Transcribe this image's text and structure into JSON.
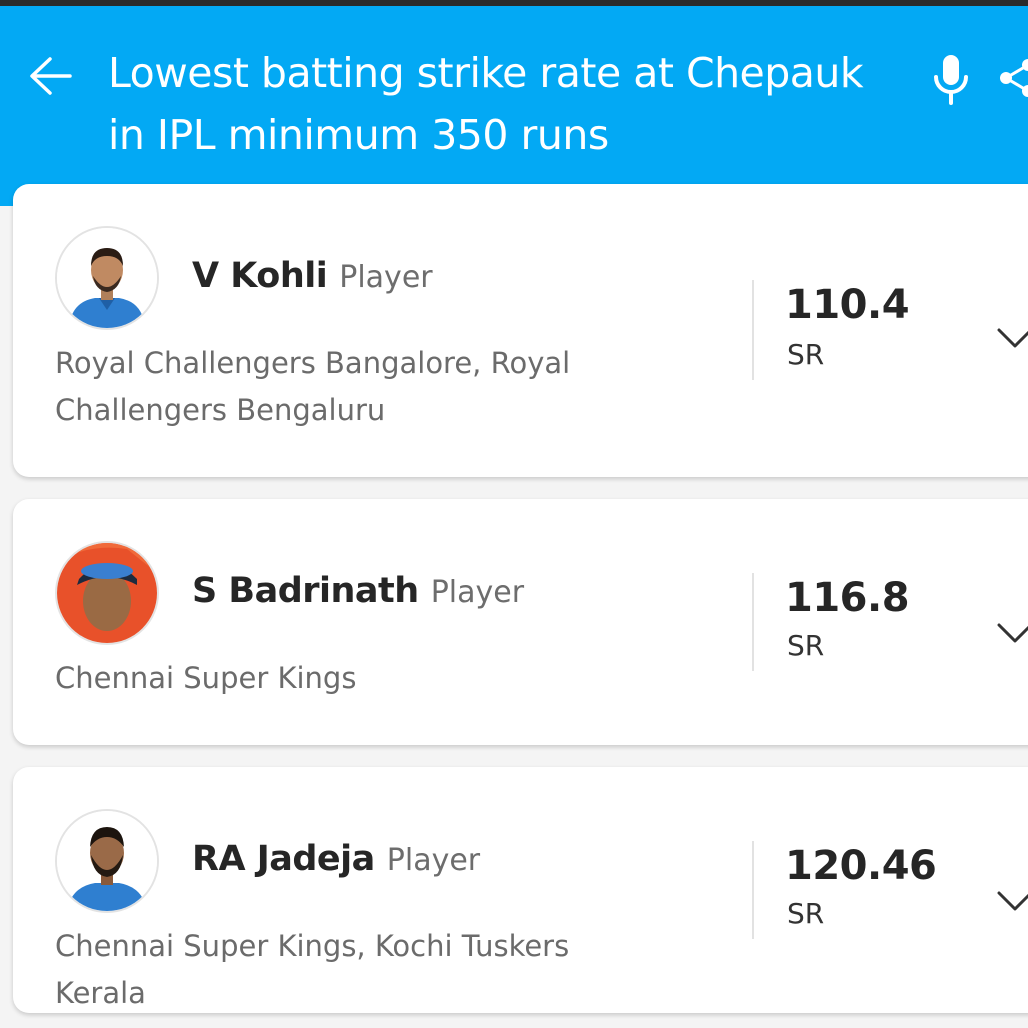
{
  "header": {
    "query": "Lowest batting strike rate at Chepauk in IPL minimum 350 runs",
    "background_color": "#03a9f4",
    "icons": [
      "back-arrow-icon",
      "microphone-icon",
      "share-icon"
    ]
  },
  "results": [
    {
      "name": "V Kohli",
      "role": "Player",
      "teams": "Royal Challengers Bangalore, Royal Challengers Bengaluru",
      "stat_value": "110.4",
      "stat_label": "SR"
    },
    {
      "name": "S Badrinath",
      "role": "Player",
      "teams": "Chennai Super Kings",
      "stat_value": "116.8",
      "stat_label": "SR"
    },
    {
      "name": "RA Jadeja",
      "role": "Player",
      "teams": "Chennai Super Kings, Kochi Tuskers Kerala",
      "stat_value": "120.46",
      "stat_label": "SR"
    }
  ]
}
